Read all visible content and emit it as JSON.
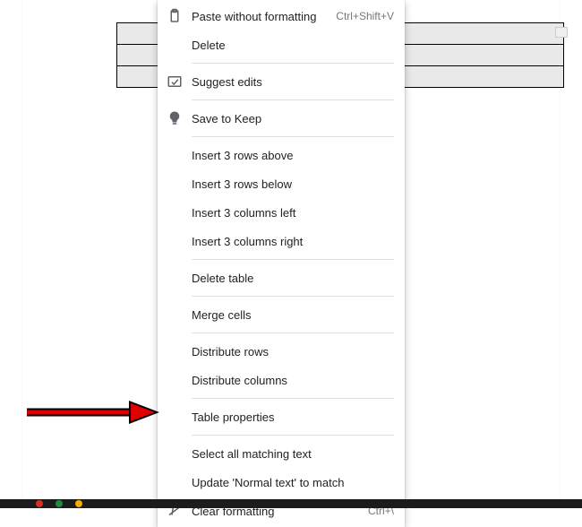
{
  "menu": {
    "paste_without_formatting": {
      "label": "Paste without formatting",
      "shortcut": "Ctrl+Shift+V"
    },
    "delete": {
      "label": "Delete"
    },
    "suggest_edits": {
      "label": "Suggest edits"
    },
    "save_to_keep": {
      "label": "Save to Keep"
    },
    "insert_rows_above": {
      "label": "Insert 3 rows above"
    },
    "insert_rows_below": {
      "label": "Insert 3 rows below"
    },
    "insert_cols_left": {
      "label": "Insert 3 columns left"
    },
    "insert_cols_right": {
      "label": "Insert 3 columns right"
    },
    "delete_table": {
      "label": "Delete table"
    },
    "merge_cells": {
      "label": "Merge cells"
    },
    "distribute_rows": {
      "label": "Distribute rows"
    },
    "distribute_columns": {
      "label": "Distribute columns"
    },
    "table_properties": {
      "label": "Table properties"
    },
    "select_matching": {
      "label": "Select all matching text"
    },
    "update_normal": {
      "label": "Update 'Normal text' to match"
    },
    "clear_formatting": {
      "label": "Clear formatting",
      "shortcut": "Ctrl+\\"
    }
  },
  "table": {
    "rows": 3,
    "cols": 1
  }
}
